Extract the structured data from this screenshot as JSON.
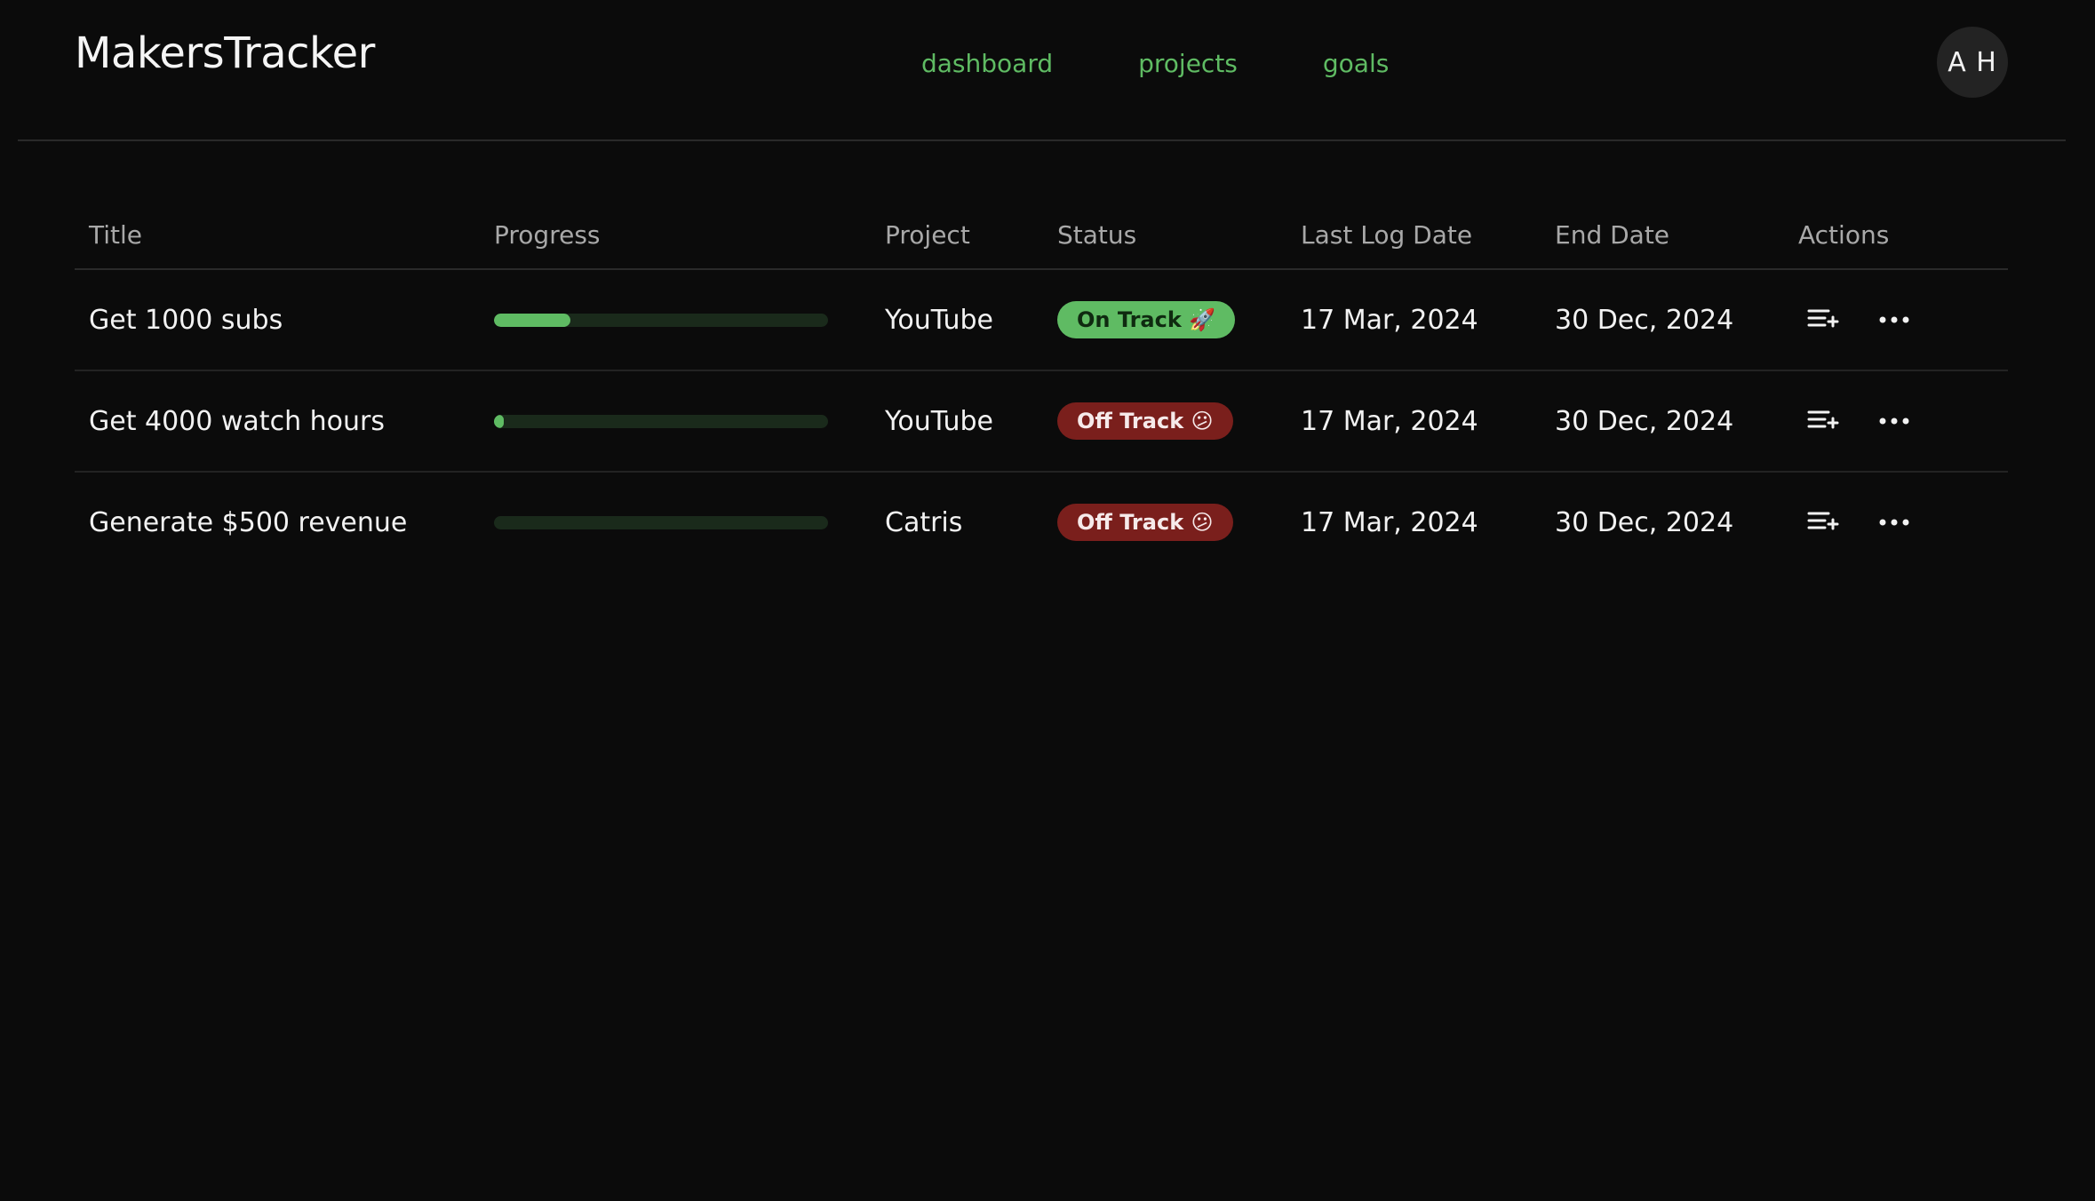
{
  "app": {
    "brand": "MakersTracker",
    "nav": [
      "dashboard",
      "projects",
      "goals"
    ],
    "avatar_initials": "A H",
    "accent_color": "#5fbb63"
  },
  "table": {
    "columns": [
      "Title",
      "Progress",
      "Project",
      "Status",
      "Last Log Date",
      "End Date",
      "Actions"
    ],
    "rows": [
      {
        "title": "Get 1000 subs",
        "progress": 0.23,
        "project": "YouTube",
        "status": "On Track 🚀",
        "status_type": "on",
        "last_log": "17 Mar, 2024",
        "end_date": "30 Dec, 2024",
        "actions": [
          "add-log-icon",
          "more-icon"
        ]
      },
      {
        "title": "Get 4000 watch hours",
        "progress": 0.03,
        "project": "YouTube",
        "status": "Off Track 😕",
        "status_type": "off",
        "last_log": "17 Mar, 2024",
        "end_date": "30 Dec, 2024",
        "actions": [
          "add-log-icon",
          "more-icon"
        ]
      },
      {
        "title": "Generate $500 revenue",
        "progress": 0,
        "project": "Catris",
        "status": "Off Track 😕",
        "status_type": "off",
        "last_log": "17 Mar, 2024",
        "end_date": "30 Dec, 2024",
        "actions": [
          "add-log-icon",
          "more-icon"
        ]
      }
    ]
  }
}
